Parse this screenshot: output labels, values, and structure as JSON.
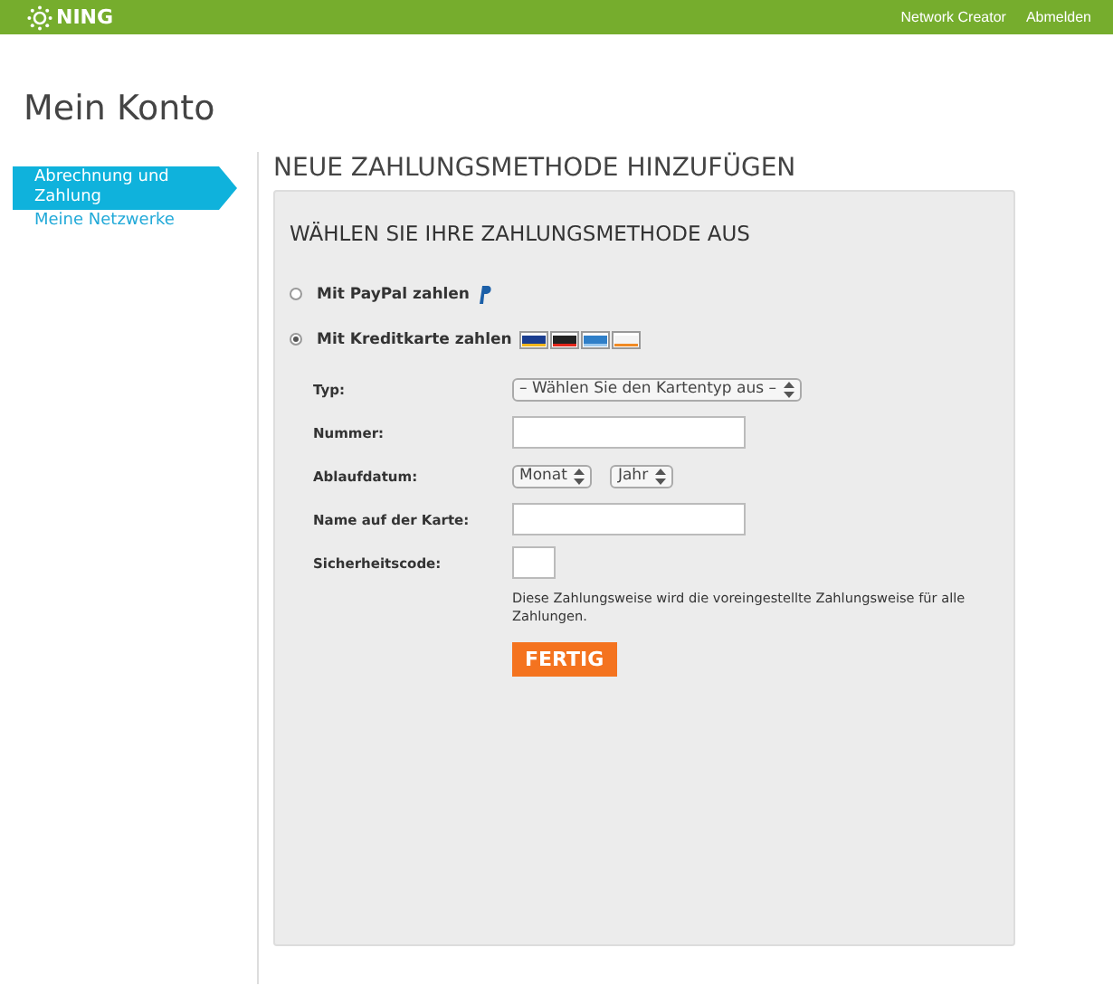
{
  "topbar": {
    "logo": "NING",
    "links": [
      "Network Creator",
      "Abmelden"
    ]
  },
  "page_title": "Mein Konto",
  "sidebar": {
    "items": [
      {
        "label": "Abrechnung und Zahlung",
        "selected": true
      },
      {
        "label": "Meine Netzwerke",
        "selected": false
      }
    ]
  },
  "main": {
    "heading": "NEUE ZAHLUNGSMETHODE HINZUFÜGEN",
    "panel_heading": "WÄHLEN SIE IHRE ZAHLUNGSMETHODE AUS",
    "methods": [
      {
        "label": "Mit PayPal zahlen",
        "kind": "paypal",
        "selected": false
      },
      {
        "label": "Mit Kreditkarte zahlen",
        "kind": "cards",
        "selected": true
      }
    ],
    "fields": [
      {
        "label": "Typ:",
        "kind": "select",
        "values": [
          "– Wählen Sie den Kartentyp aus –"
        ]
      },
      {
        "label": "Nummer:",
        "kind": "input"
      },
      {
        "label": "Ablaufdatum:",
        "kind": "selects",
        "values": [
          "Monat",
          "Jahr"
        ]
      },
      {
        "label": "Name auf der Karte:",
        "kind": "input"
      },
      {
        "label": "Sicherheitscode:",
        "kind": "short"
      }
    ],
    "note": "Diese Zahlungsweise wird die voreingestellte Zahlungsweise für alle Zahlungen.",
    "submit": "FERTIG"
  }
}
